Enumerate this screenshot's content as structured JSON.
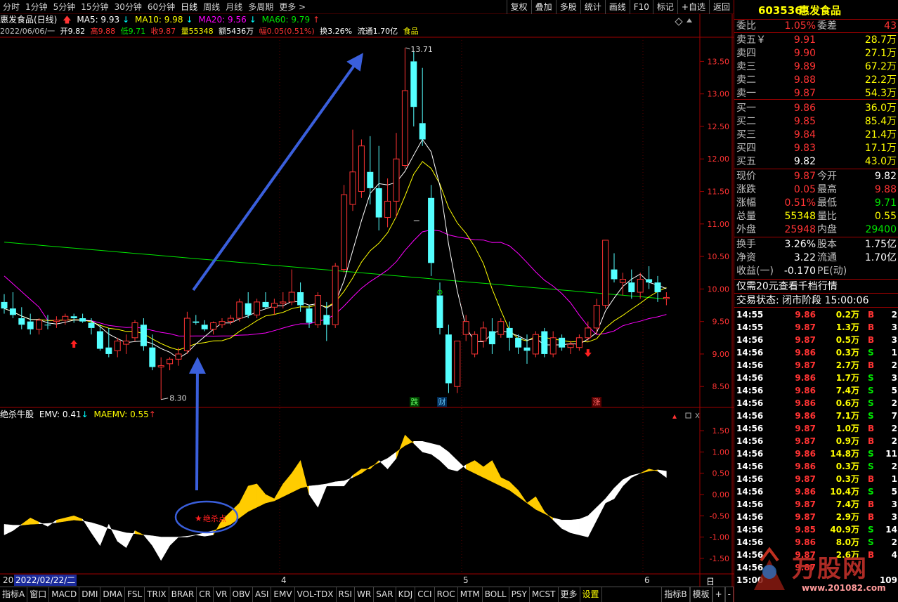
{
  "toolbar": {
    "timeframes": [
      "分时",
      "1分钟",
      "5分钟",
      "15分钟",
      "30分钟",
      "60分钟",
      "日线",
      "周线",
      "月线",
      "多周期",
      "更多 >"
    ],
    "active_timeframe": "日线",
    "buttons": [
      "复权",
      "叠加",
      "多股",
      "统计",
      "画线",
      "F10",
      "标记",
      "+自选",
      "返回"
    ]
  },
  "chart_header": {
    "title": "惠发食品(日线)",
    "ma5": "MA5: 9.93",
    "ma10": "MA10: 9.98",
    "ma20": "MA20: 9.56",
    "ma60": "MA60: 9.79",
    "date": "2022/06/06/一",
    "open": "开9.82",
    "high": "高9.88",
    "low": "低9.71",
    "close": "收9.87",
    "vol": "量55348",
    "amount": "额5436万",
    "range": "幅0.05(0.51%)",
    "turnover": "换3.26%",
    "float": "流通1.70亿",
    "sector": "食品"
  },
  "colors": {
    "up": "#ff3333",
    "down": "#54ffff",
    "ma5": "#ffffff",
    "ma10": "#ffff00",
    "ma20": "#ff00ff",
    "ma60": "#00e600",
    "emv": "#ffffff",
    "maemv": "#ffcc00",
    "grid": "#a00000"
  },
  "indicator_header": {
    "name": "绝杀牛股",
    "emv": "EMV: 0.41",
    "maemv": "MAEMV: 0.55"
  },
  "annotations": {
    "high_label": "13.71",
    "low_label": "8.30",
    "kill_point": "绝杀点",
    "badge_die": "跌",
    "badge_cai": "财",
    "badge_zhang": "涨"
  },
  "price_axis": [
    "13.50",
    "13.00",
    "12.50",
    "12.00",
    "11.50",
    "11.00",
    "10.50",
    "10.00",
    "9.50",
    "9.00",
    "8.50"
  ],
  "indicator_axis": [
    "1.50",
    "1.00",
    "0.50",
    "0.00",
    "-0.50",
    "-1.00",
    "-1.50"
  ],
  "date_axis": {
    "start_prefix": "20",
    "selected_date": "2022/02/22/二",
    "months": [
      "4",
      "5",
      "6"
    ],
    "right_label": "日线"
  },
  "bottom_tabs": [
    "指标A",
    "窗口",
    "MACD",
    "DMI",
    "DMA",
    "FSL",
    "TRIX",
    "BRAR",
    "CR",
    "VR",
    "OBV",
    "ASI",
    "EMV",
    "VOL-TDX",
    "RSI",
    "WR",
    "SAR",
    "KDJ",
    "CCI",
    "ROC",
    "MTM",
    "BOLL",
    "PSY",
    "MCST",
    "更多",
    "设置"
  ],
  "bottom_right_tabs": [
    "指标B",
    "模板",
    "+",
    "-"
  ],
  "quote": {
    "code": "603536",
    "name": "惠发食品",
    "weibi_label": "委比",
    "weibi": "1.05%",
    "weicha_label": "委差",
    "weicha": "43",
    "sell": [
      {
        "label": "卖五￥",
        "price": "9.91",
        "vol": "28.7万"
      },
      {
        "label": "卖四",
        "price": "9.90",
        "vol": "27.1万"
      },
      {
        "label": "卖三",
        "price": "9.89",
        "vol": "67.2万"
      },
      {
        "label": "卖二",
        "price": "9.88",
        "vol": "22.2万"
      },
      {
        "label": "卖一",
        "price": "9.87",
        "vol": "54.3万"
      }
    ],
    "buy": [
      {
        "label": "买一",
        "price": "9.86",
        "vol": "36.0万"
      },
      {
        "label": "买二",
        "price": "9.85",
        "vol": "85.4万"
      },
      {
        "label": "买三",
        "price": "9.84",
        "vol": "21.4万"
      },
      {
        "label": "买四",
        "price": "9.83",
        "vol": "17.1万"
      },
      {
        "label": "买五",
        "price": "9.82",
        "vol": "43.0万"
      }
    ],
    "stats1": [
      {
        "l1": "现价",
        "v1": "9.87",
        "c1": "red",
        "l2": "今开",
        "v2": "9.82",
        "c2": "white"
      },
      {
        "l1": "涨跌",
        "v1": "0.05",
        "c1": "red",
        "l2": "最高",
        "v2": "9.88",
        "c2": "red"
      },
      {
        "l1": "涨幅",
        "v1": "0.51%",
        "c1": "red",
        "l2": "最低",
        "v2": "9.71",
        "c2": "green"
      },
      {
        "l1": "总量",
        "v1": "55348",
        "c1": "yellow",
        "l2": "量比",
        "v2": "0.55",
        "c2": "yellow"
      },
      {
        "l1": "外盘",
        "v1": "25948",
        "c1": "red",
        "l2": "内盘",
        "v2": "29400",
        "c2": "green"
      }
    ],
    "stats2": [
      {
        "l1": "换手",
        "v1": "3.26%",
        "l2": "股本",
        "v2": "1.75亿"
      },
      {
        "l1": "净资",
        "v1": "3.22",
        "l2": "流通",
        "v2": "1.70亿"
      },
      {
        "l1": "收益(一)",
        "v1": "-0.170",
        "l2": "PE(动)",
        "v2": ""
      }
    ],
    "promo": "仅需20元查看千档行情",
    "status": "交易状态: 闭市阶段 15:00:06",
    "ticks": [
      {
        "t": "14:55",
        "p": "9.86",
        "v": "0.2万",
        "s": "B",
        "n": "2"
      },
      {
        "t": "14:55",
        "p": "9.87",
        "v": "1.3万",
        "s": "B",
        "n": "3"
      },
      {
        "t": "14:56",
        "p": "9.87",
        "v": "0.5万",
        "s": "B",
        "n": "3"
      },
      {
        "t": "14:56",
        "p": "9.86",
        "v": "0.3万",
        "s": "S",
        "n": "1"
      },
      {
        "t": "14:56",
        "p": "9.87",
        "v": "2.7万",
        "s": "B",
        "n": "2"
      },
      {
        "t": "14:56",
        "p": "9.86",
        "v": "1.7万",
        "s": "S",
        "n": "3"
      },
      {
        "t": "14:56",
        "p": "9.86",
        "v": "7.4万",
        "s": "S",
        "n": "5"
      },
      {
        "t": "14:56",
        "p": "9.86",
        "v": "0.6万",
        "s": "S",
        "n": "2"
      },
      {
        "t": "14:56",
        "p": "9.86",
        "v": "7.1万",
        "s": "S",
        "n": "7"
      },
      {
        "t": "14:56",
        "p": "9.87",
        "v": "1.0万",
        "s": "B",
        "n": "2"
      },
      {
        "t": "14:56",
        "p": "9.87",
        "v": "0.9万",
        "s": "B",
        "n": "2"
      },
      {
        "t": "14:56",
        "p": "9.86",
        "v": "14.8万",
        "s": "S",
        "n": "11"
      },
      {
        "t": "14:56",
        "p": "9.86",
        "v": "0.3万",
        "s": "S",
        "n": "2"
      },
      {
        "t": "14:56",
        "p": "9.87",
        "v": "0.3万",
        "s": "B",
        "n": "1"
      },
      {
        "t": "14:56",
        "p": "9.86",
        "v": "10.4万",
        "s": "S",
        "n": "5"
      },
      {
        "t": "14:56",
        "p": "9.87",
        "v": "7.4万",
        "s": "B",
        "n": "3"
      },
      {
        "t": "14:56",
        "p": "9.87",
        "v": "2.9万",
        "s": "B",
        "n": "3"
      },
      {
        "t": "14:56",
        "p": "9.85",
        "v": "40.9万",
        "s": "S",
        "n": "14"
      },
      {
        "t": "14:56",
        "p": "9.86",
        "v": "8.0万",
        "s": "S",
        "n": "2"
      },
      {
        "t": "14:56",
        "p": "9.87",
        "v": "2.6万",
        "s": "B",
        "n": "4"
      },
      {
        "t": "14:56",
        "p": "9.87",
        "v": "",
        "s": "",
        "n": ""
      },
      {
        "t": "15:00",
        "p": "",
        "v": "",
        "s": "",
        "n": "109"
      }
    ]
  },
  "watermark": {
    "text": "万股网",
    "url": "www.201082.com"
  },
  "chart_data": {
    "type": "candlestick",
    "ohlc": [
      [
        9.8,
        9.92,
        9.62,
        9.7
      ],
      [
        9.7,
        9.95,
        9.55,
        9.6
      ],
      [
        9.55,
        9.72,
        9.38,
        9.45
      ],
      [
        9.5,
        9.62,
        9.3,
        9.38
      ],
      [
        9.38,
        9.55,
        9.3,
        9.52
      ],
      [
        9.45,
        9.6,
        9.38,
        9.44
      ],
      [
        9.5,
        9.58,
        9.4,
        9.52
      ],
      [
        9.52,
        9.62,
        9.45,
        9.58
      ],
      [
        9.58,
        9.62,
        9.48,
        9.55
      ],
      [
        9.55,
        9.62,
        9.48,
        9.5
      ],
      [
        9.48,
        9.55,
        9.3,
        9.4
      ],
      [
        9.35,
        9.45,
        9.05,
        9.08
      ],
      [
        9.1,
        9.4,
        8.95,
        9.0
      ],
      [
        9.05,
        9.25,
        8.95,
        9.2
      ],
      [
        9.15,
        9.3,
        9.0,
        9.2
      ],
      [
        9.25,
        9.52,
        9.2,
        9.48
      ],
      [
        9.45,
        9.55,
        9.05,
        9.12
      ],
      [
        9.1,
        9.3,
        8.75,
        8.8
      ],
      [
        8.8,
        8.95,
        8.3,
        8.82
      ],
      [
        8.85,
        8.95,
        8.75,
        8.92
      ],
      [
        8.92,
        9.1,
        8.82,
        9.0
      ],
      [
        9.05,
        9.65,
        9.0,
        9.55
      ],
      [
        9.5,
        9.6,
        9.45,
        9.48
      ],
      [
        9.45,
        9.52,
        9.35,
        9.38
      ],
      [
        9.38,
        9.5,
        9.3,
        9.48
      ],
      [
        9.45,
        9.55,
        9.4,
        9.5
      ],
      [
        9.5,
        9.6,
        9.45,
        9.55
      ],
      [
        9.55,
        9.85,
        9.5,
        9.8
      ],
      [
        9.78,
        9.95,
        9.55,
        9.6
      ],
      [
        9.6,
        9.85,
        9.55,
        9.8
      ],
      [
        9.8,
        9.95,
        9.7,
        9.72
      ],
      [
        9.72,
        9.85,
        9.6,
        9.78
      ],
      [
        9.78,
        9.95,
        9.7,
        9.8
      ],
      [
        9.8,
        10.3,
        9.75,
        9.95
      ],
      [
        9.95,
        10.1,
        9.65,
        9.75
      ],
      [
        9.7,
        9.75,
        9.4,
        9.48
      ],
      [
        9.45,
        9.95,
        9.4,
        9.9
      ],
      [
        9.6,
        9.8,
        9.2,
        9.45
      ],
      [
        9.45,
        10.4,
        9.4,
        10.35
      ],
      [
        10.3,
        11.6,
        10.25,
        11.45
      ],
      [
        11.3,
        12.45,
        11.2,
        11.8
      ],
      [
        11.5,
        12.3,
        11.4,
        12.2
      ],
      [
        11.8,
        12.35,
        11.3,
        11.55
      ],
      [
        11.55,
        12.2,
        10.9,
        11.1
      ],
      [
        11.1,
        11.7,
        10.95,
        11.35
      ],
      [
        11.35,
        12.4,
        11.1,
        12.0
      ],
      [
        11.9,
        13.71,
        11.85,
        13.05
      ],
      [
        13.5,
        13.65,
        12.5,
        12.8
      ],
      [
        12.55,
        13.4,
        12.2,
        12.3
      ],
      [
        11.4,
        11.6,
        10.2,
        10.4
      ],
      [
        9.9,
        10.1,
        9.3,
        9.4
      ],
      [
        9.3,
        9.45,
        8.4,
        8.55
      ],
      [
        8.5,
        9.2,
        8.4,
        9.2
      ],
      [
        9.3,
        9.6,
        9.2,
        9.5
      ],
      [
        9.0,
        9.35,
        8.95,
        9.3
      ],
      [
        9.2,
        9.5,
        9.1,
        9.4
      ],
      [
        9.35,
        9.55,
        9.0,
        9.15
      ],
      [
        9.3,
        9.55,
        9.25,
        9.5
      ],
      [
        9.4,
        9.5,
        9.05,
        9.25
      ],
      [
        9.25,
        9.3,
        9.0,
        9.1
      ],
      [
        9.1,
        9.3,
        8.85,
        9.05
      ],
      [
        9.0,
        9.35,
        8.95,
        9.3
      ],
      [
        9.35,
        9.4,
        8.95,
        9.0
      ],
      [
        9.0,
        9.35,
        8.95,
        9.25
      ],
      [
        9.25,
        9.3,
        9.05,
        9.1
      ],
      [
        9.1,
        9.2,
        9.0,
        9.15
      ],
      [
        9.1,
        9.3,
        9.05,
        9.25
      ],
      [
        9.25,
        9.5,
        9.2,
        9.4
      ],
      [
        9.4,
        9.85,
        9.3,
        9.75
      ],
      [
        9.75,
        10.75,
        9.7,
        10.75
      ],
      [
        10.3,
        10.55,
        10.1,
        10.15
      ],
      [
        10.1,
        10.25,
        9.9,
        10.15
      ],
      [
        10.1,
        10.3,
        9.85,
        9.95
      ],
      [
        9.95,
        10.25,
        9.85,
        10.15
      ],
      [
        10.15,
        10.35,
        10.0,
        10.1
      ],
      [
        10.1,
        10.2,
        9.8,
        9.95
      ],
      [
        9.85,
        9.95,
        9.75,
        9.87
      ]
    ],
    "emv": [
      -0.95,
      -0.85,
      -0.7,
      -0.55,
      -0.65,
      -0.75,
      -0.6,
      -0.55,
      -0.5,
      -0.58,
      -0.9,
      -1.2,
      -0.7,
      -1.1,
      -1.25,
      -0.85,
      -0.95,
      -1.2,
      -1.55,
      -1.2,
      -1.0,
      -1.0,
      -0.95,
      -0.98,
      -0.95,
      -0.6,
      -0.4,
      -0.2,
      0.2,
      0.25,
      0.0,
      -0.1,
      0.25,
      0.5,
      0.8,
      0.0,
      -0.3,
      0.2,
      0.2,
      0.2,
      0.45,
      0.6,
      0.6,
      0.8,
      0.6,
      0.85,
      1.4,
      1.2,
      1.0,
      0.95,
      0.8,
      0.6,
      0.55,
      0.7,
      0.8,
      0.65,
      0.8,
      0.4,
      0.3,
      0.1,
      -0.2,
      -0.05,
      -0.4,
      -0.6,
      -0.8,
      -0.9,
      -0.95,
      -1.0,
      -0.6,
      -0.2,
      -0.1,
      0.2,
      0.4,
      0.5,
      0.6,
      0.55,
      0.4
    ],
    "maemv": [
      -0.7,
      -0.72,
      -0.72,
      -0.7,
      -0.69,
      -0.68,
      -0.66,
      -0.63,
      -0.6,
      -0.62,
      -0.66,
      -0.72,
      -0.8,
      -0.85,
      -0.9,
      -0.92,
      -0.95,
      -0.97,
      -1.0,
      -1.0,
      -1.0,
      -0.98,
      -0.95,
      -0.9,
      -0.85,
      -0.78,
      -0.7,
      -0.55,
      -0.4,
      -0.3,
      -0.2,
      -0.15,
      -0.05,
      0.05,
      0.15,
      0.2,
      0.22,
      0.25,
      0.3,
      0.32,
      0.4,
      0.5,
      0.65,
      0.75,
      0.85,
      1.0,
      1.15,
      1.25,
      1.25,
      1.2,
      1.15,
      1.0,
      0.8,
      0.6,
      0.5,
      0.4,
      0.3,
      0.2,
      0.1,
      -0.05,
      -0.2,
      -0.35,
      -0.45,
      -0.55,
      -0.6,
      -0.6,
      -0.58,
      -0.5,
      -0.3,
      -0.1,
      0.15,
      0.35,
      0.45,
      0.5,
      0.55,
      0.58,
      0.55
    ],
    "price_ylim": [
      8.2,
      13.85
    ],
    "indicator_ylim": [
      -1.85,
      1.75
    ]
  }
}
